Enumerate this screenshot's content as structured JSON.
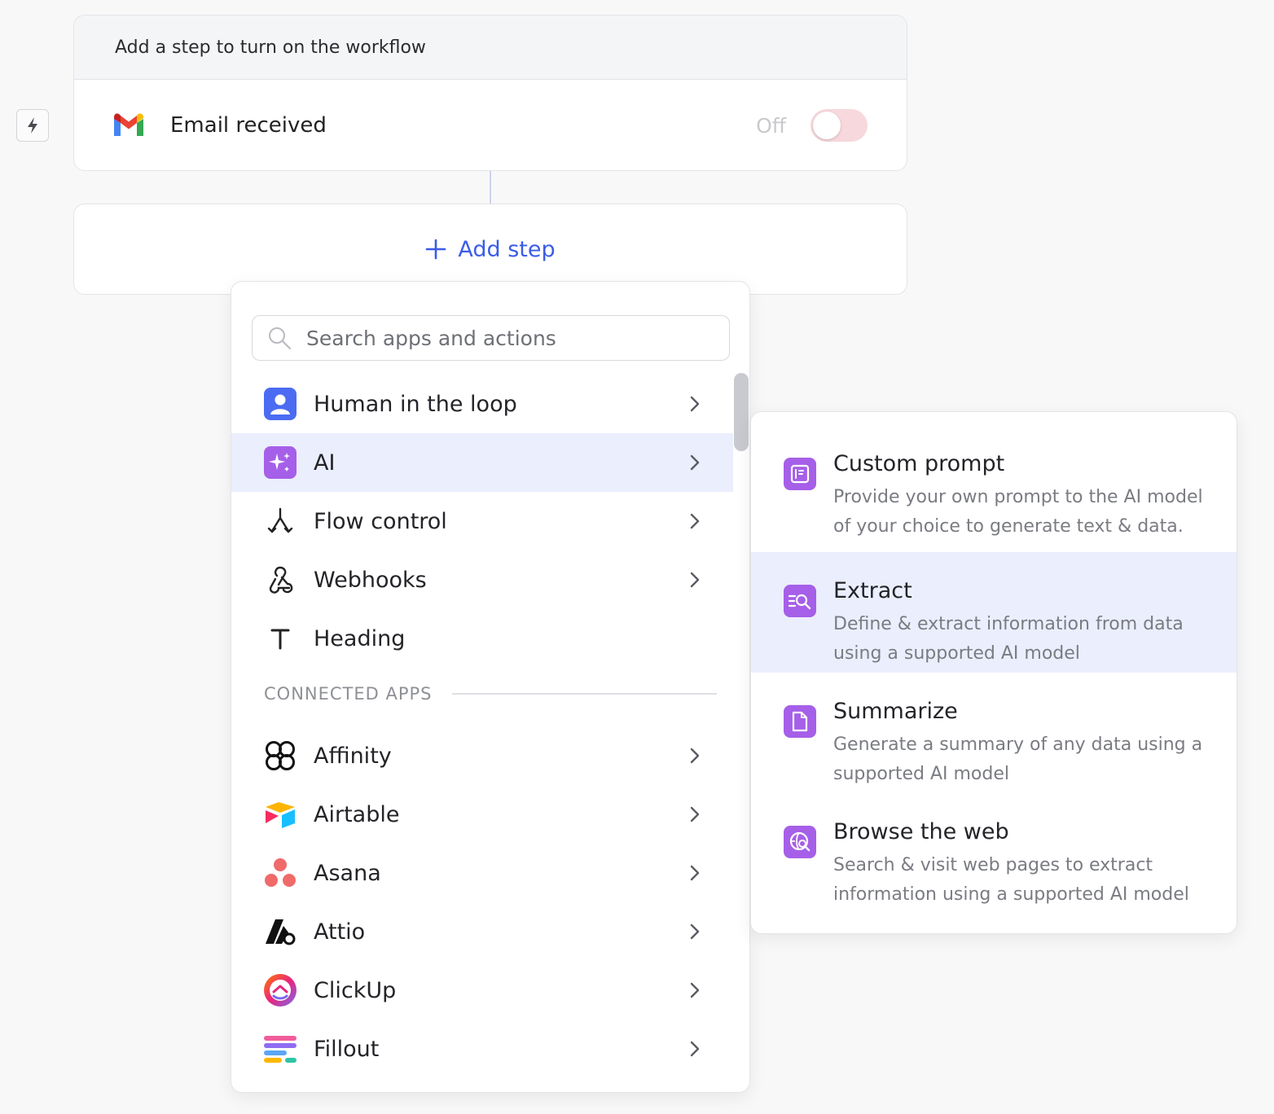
{
  "workflow": {
    "banner": "Add a step to turn on the workflow",
    "trigger_label": "Email received",
    "toggle_state": "Off"
  },
  "add_step": {
    "label": "Add step"
  },
  "menu": {
    "search_placeholder": "Search apps and actions",
    "items": [
      {
        "label": "Human in the loop",
        "icon": "person-icon"
      },
      {
        "label": "AI",
        "icon": "sparkle-icon"
      },
      {
        "label": "Flow control",
        "icon": "branch-icon"
      },
      {
        "label": "Webhooks",
        "icon": "webhook-icon"
      },
      {
        "label": "Heading",
        "icon": "text-t-icon"
      }
    ],
    "section_title": "CONNECTED APPS",
    "apps": [
      {
        "label": "Affinity",
        "icon": "affinity-logo"
      },
      {
        "label": "Airtable",
        "icon": "airtable-logo"
      },
      {
        "label": "Asana",
        "icon": "asana-logo"
      },
      {
        "label": "Attio",
        "icon": "attio-logo"
      },
      {
        "label": "ClickUp",
        "icon": "clickup-logo"
      },
      {
        "label": "Fillout",
        "icon": "fillout-logo"
      }
    ]
  },
  "submenu": {
    "items": [
      {
        "title": "Custom prompt",
        "desc_1": "Provide your own prompt to the AI model",
        "desc_2": "of your choice to generate text & data."
      },
      {
        "title": "Extract",
        "desc_1": "Define & extract information from data",
        "desc_2": "using a supported AI model"
      },
      {
        "title": "Summarize",
        "desc_1": "Generate a summary of any data using a",
        "desc_2": "supported AI model"
      },
      {
        "title": "Browse the web",
        "desc_1": "Search & visit web pages to extract",
        "desc_2": "information using a supported AI model"
      }
    ]
  },
  "colors": {
    "accent": "#3b5ce6",
    "ai_purple": "#a65fe8",
    "hover_bg": "#ebeefd",
    "toggle_off": "#f7d8dc"
  }
}
